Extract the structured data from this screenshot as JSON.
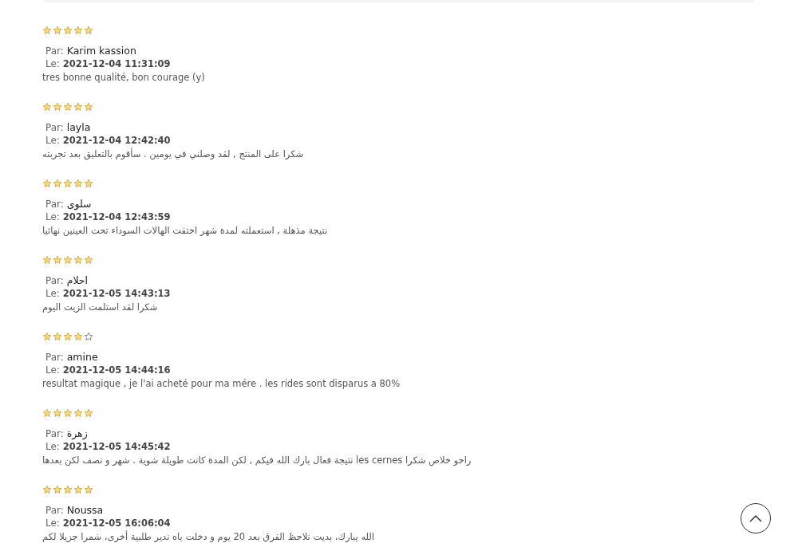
{
  "reviews": [
    {
      "stars": 5,
      "by_label": "Par:",
      "author": "Karim kassion",
      "date_label": "Le:",
      "date": "2021-12-04 11:31:09",
      "comment": "tres bonne qualité, bon courage (y)"
    },
    {
      "stars": 5,
      "by_label": "Par:",
      "author": "layla",
      "date_label": "Le:",
      "date": "2021-12-04 12:42:40",
      "comment": "شكرا على المنتج , لقد وصلني في يومين . سأقوم بالتعليق بعد تجربته"
    },
    {
      "stars": 5,
      "by_label": "Par:",
      "author": "سلوى",
      "date_label": "Le:",
      "date": "2021-12-04 12:43:59",
      "comment": "نتيجة مذهلة , استعملته لمدة شهر اختفت الهالات السوداء تحت العينين نهائيا"
    },
    {
      "stars": 5,
      "by_label": "Par:",
      "author": "احلام",
      "date_label": "Le:",
      "date": "2021-12-05 14:43:13",
      "comment": "شكرا لقد استلمت الزيت اليوم"
    },
    {
      "stars": 4,
      "by_label": "Par:",
      "author": "amine",
      "date_label": "Le:",
      "date": "2021-12-05 14:44:16",
      "comment": "resultat magique , je l'ai acheté pour ma mére . les rides sont disparus a 80%"
    },
    {
      "stars": 5,
      "by_label": "Par:",
      "author": "زهرة",
      "date_label": "Le:",
      "date": "2021-12-05 14:45:42",
      "comment": "راحو خلاص شكرا les cernes نتيجة فعال بارك الله فيكم , لكن المدة كانت طويلة شوية . شهر و نصف لكن بعدها"
    },
    {
      "stars": 5,
      "by_label": "Par:",
      "author": "Noussa",
      "date_label": "Le:",
      "date": "2021-12-05 16:06:04",
      "comment": "الله يبارك، بديت نلاحظ الفرق بعد 20 يوم و دخلت باه ندير طلبية أخرى، شمرا جزيلا لكم"
    }
  ]
}
